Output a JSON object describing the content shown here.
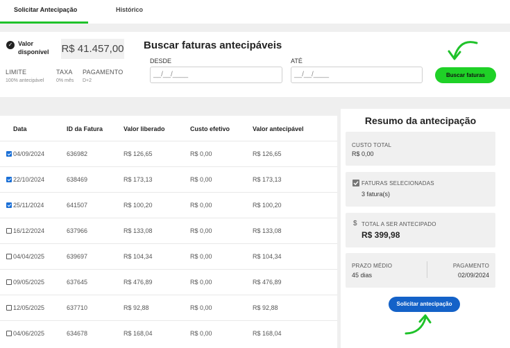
{
  "tabs": [
    {
      "label": "Solicitar Antecipação",
      "active": true
    },
    {
      "label": "Histórico",
      "active": false
    }
  ],
  "balance": {
    "label": "Valor disponível",
    "value": "R$ 41.457,00",
    "limite_label": "LIMITE",
    "limite_value": "100% antecipável",
    "taxa_label": "TAXA",
    "taxa_value": "0% mês",
    "pagamento_label": "PAGAMENTO",
    "pagamento_value": "D+2"
  },
  "search": {
    "title": "Buscar faturas antecipáveis",
    "desde_label": "DESDE",
    "desde_value": "__/__/____",
    "ate_label": "ATÉ",
    "ate_value": "__/__/____",
    "button_label": "Buscar faturas"
  },
  "table": {
    "headers": [
      "Data",
      "ID da Fatura",
      "Valor liberado",
      "Custo efetivo",
      "Valor antecipável"
    ],
    "rows": [
      {
        "checked": true,
        "data": "04/09/2024",
        "id": "636982",
        "liberado": "R$ 126,65",
        "custo": "R$ 0,00",
        "antecipavel": "R$ 126,65"
      },
      {
        "checked": true,
        "data": "22/10/2024",
        "id": "638469",
        "liberado": "R$ 173,13",
        "custo": "R$ 0,00",
        "antecipavel": "R$ 173,13"
      },
      {
        "checked": true,
        "data": "25/11/2024",
        "id": "641507",
        "liberado": "R$ 100,20",
        "custo": "R$ 0,00",
        "antecipavel": "R$ 100,20"
      },
      {
        "checked": false,
        "data": "16/12/2024",
        "id": "637966",
        "liberado": "R$ 133,08",
        "custo": "R$ 0,00",
        "antecipavel": "R$ 133,08"
      },
      {
        "checked": false,
        "data": "04/04/2025",
        "id": "639697",
        "liberado": "R$ 104,34",
        "custo": "R$ 0,00",
        "antecipavel": "R$ 104,34"
      },
      {
        "checked": false,
        "data": "09/05/2025",
        "id": "637645",
        "liberado": "R$ 476,89",
        "custo": "R$ 0,00",
        "antecipavel": "R$ 476,89"
      },
      {
        "checked": false,
        "data": "12/05/2025",
        "id": "637710",
        "liberado": "R$ 92,88",
        "custo": "R$ 0,00",
        "antecipavel": "R$ 92,88"
      },
      {
        "checked": false,
        "data": "04/06/2025",
        "id": "634678",
        "liberado": "R$ 168,04",
        "custo": "R$ 0,00",
        "antecipavel": "R$ 168,04"
      }
    ]
  },
  "summary": {
    "title": "Resumo da antecipação",
    "custo_label": "CUSTO TOTAL",
    "custo_value": "R$ 0,00",
    "faturas_label": "FATURAS SELECIONADAS",
    "faturas_value": "3 fatura(s)",
    "total_label": "TOTAL A SER ANTECIPADO",
    "total_value": "R$ 399,98",
    "prazo_label": "PRAZO MÉDIO",
    "prazo_value": "45 dias",
    "pagamento_label": "PAGAMENTO",
    "pagamento_value": "02/09/2024",
    "button_label": "Solicitar antecipação"
  },
  "colors": {
    "accent_green": "#1fd127",
    "primary_blue": "#1462c8",
    "background_gray": "#efefef"
  }
}
